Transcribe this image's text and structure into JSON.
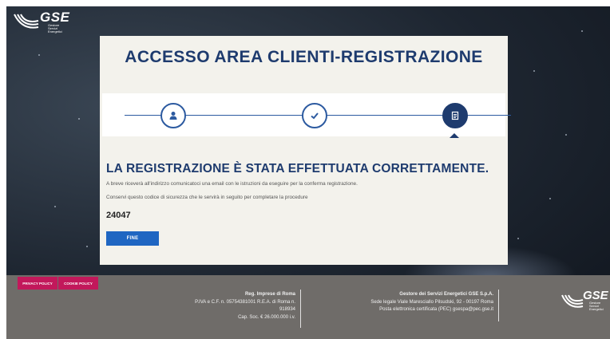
{
  "brand": {
    "logo_text": "GSE",
    "logo_sub": "Gestore Servizi Energetici"
  },
  "card": {
    "title": "ACCESSO AREA CLIENTI-REGISTRAZIONE",
    "stepper": {
      "steps": [
        {
          "icon": "user-icon",
          "state": "done"
        },
        {
          "icon": "check-icon",
          "state": "done"
        },
        {
          "icon": "document-icon",
          "state": "active"
        }
      ]
    },
    "success_title": "LA REGISTRAZIONE È STATA EFFETTUATA CORRETTAMENTE.",
    "info_line_1": "A breve riceverà all'indirizzo comunicatoci una email con le istruzioni da eseguire per la conferma registrazione.",
    "info_line_2": "Conservi questo codice di sicurezza che le servirà in seguito per completare la procedure",
    "security_code": "24047",
    "finish_button": "FINE"
  },
  "footer": {
    "privacy_policy": "PRIVACY POLICY",
    "cookie_policy": "COOKIE POLICY",
    "registry": {
      "title": "Reg. Imprese di Roma",
      "line_1": "P.IVA e C.F. n. 05754381001 R.E.A. di Roma n.",
      "line_2": "918934",
      "line_3": "Cap. Soc. € 26.000.000 i.v."
    },
    "company": {
      "title": "Gestore dei Servizi Energetici GSE S.p.A.",
      "line_1": "Sede legale Viale Maresciallo Pilsudski, 92 - 00197 Roma",
      "line_2": "Posta elettronica certificata (PEC) gsespa@pec.gse.it"
    }
  },
  "colors": {
    "primary": "#1e3b6e",
    "button": "#1f66c2",
    "pill": "#c2185b",
    "footer_bg": "#6f6c69"
  }
}
